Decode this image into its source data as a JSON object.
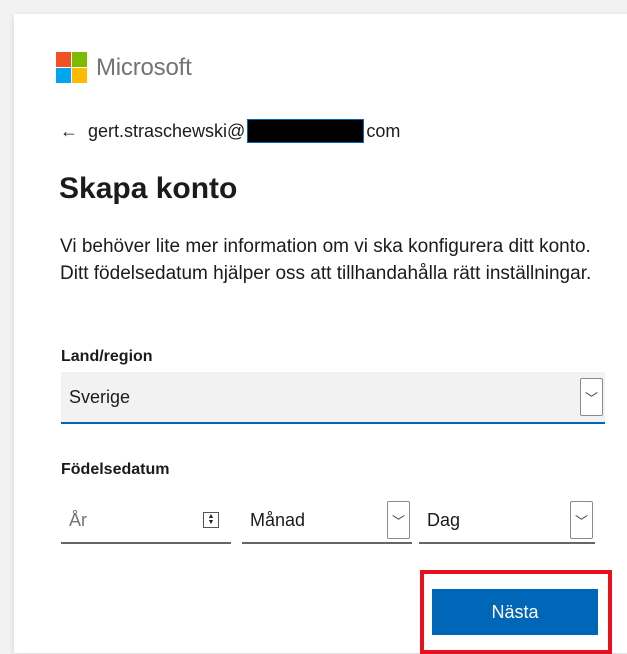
{
  "brand": {
    "name": "Microsoft",
    "logo_colors": [
      "#f25022",
      "#7fba00",
      "#00a4ef",
      "#ffb900"
    ]
  },
  "identity": {
    "back_icon": "back-arrow-icon",
    "email_prefix": "gert.straschewski@",
    "email_suffix": "com"
  },
  "page": {
    "title": "Skapa konto",
    "description": "Vi behöver lite mer information om vi ska konfigurera ditt konto. Ditt födelsedatum hjälper oss att tillhandahålla rätt inställningar."
  },
  "form": {
    "country_label": "Land/region",
    "country_value": "Sverige",
    "birthdate_label": "Födelsedatum",
    "year_placeholder": "År",
    "month_value": "Månad",
    "day_value": "Dag"
  },
  "actions": {
    "next_label": "Nästa"
  },
  "colors": {
    "accent": "#0067b8",
    "highlight": "#e8101d"
  }
}
